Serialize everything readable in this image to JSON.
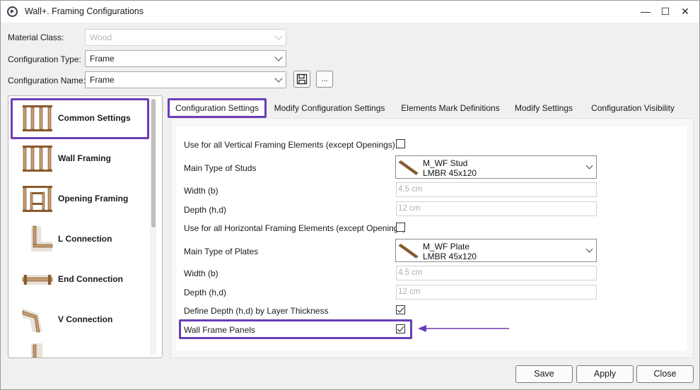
{
  "window": {
    "title": "Wall+. Framing Configurations",
    "minimize": "—",
    "maximize": "☐",
    "close": "✕"
  },
  "form": {
    "material_class_label": "Material Class:",
    "material_class_value": "Wood",
    "config_type_label": "Configuration Type:",
    "config_type_value": "Frame",
    "config_name_label": "Configuration Name:",
    "config_name_value": "Frame",
    "more_button": "..."
  },
  "sidebar": {
    "items": [
      {
        "label": "Common Settings",
        "icon": "wall-frame-icon",
        "selected": true
      },
      {
        "label": "Wall Framing",
        "icon": "wall-frame-icon"
      },
      {
        "label": "Opening Framing",
        "icon": "opening-frame-icon"
      },
      {
        "label": "L Connection",
        "icon": "l-connection-icon"
      },
      {
        "label": "End Connection",
        "icon": "end-connection-icon"
      },
      {
        "label": "V Connection",
        "icon": "v-connection-icon"
      }
    ]
  },
  "tabs": [
    {
      "label": "Configuration Settings",
      "active": true
    },
    {
      "label": "Modify Configuration Settings"
    },
    {
      "label": "Elements Mark Definitions"
    },
    {
      "label": "Modify Settings"
    },
    {
      "label": "Configuration Visibility"
    }
  ],
  "settings": {
    "vertical_all_label": "Use for all Vertical Framing Elements (except Openings)",
    "vertical_all_checked": false,
    "studs_label": "Main Type of Studs",
    "studs_name": "M_WF Stud",
    "studs_size": "LMBR 45x120",
    "stud_width_label": "Width (b)",
    "stud_width_value": "4.5 cm",
    "stud_depth_label": "Depth (h,d)",
    "stud_depth_value": "12 cm",
    "horizontal_all_label": "Use for all Horizontal Framing Elements (except Openings)",
    "horizontal_all_checked": false,
    "plates_label": "Main Type of Plates",
    "plates_name": "M_WF Plate",
    "plates_size": "LMBR 45x120",
    "plate_width_label": "Width (b)",
    "plate_width_value": "4.5 cm",
    "plate_depth_label": "Depth (h,d)",
    "plate_depth_value": "12 cm",
    "depth_by_layer_label": "Define Depth (h,d) by Layer Thickness",
    "depth_by_layer_checked": true,
    "wall_frame_panels_label": "Wall Frame Panels",
    "wall_frame_panels_checked": true
  },
  "footer": {
    "save": "Save",
    "apply": "Apply",
    "close": "Close"
  },
  "colors": {
    "highlight": "#6a3db5",
    "wood": "#8b5a2b"
  }
}
